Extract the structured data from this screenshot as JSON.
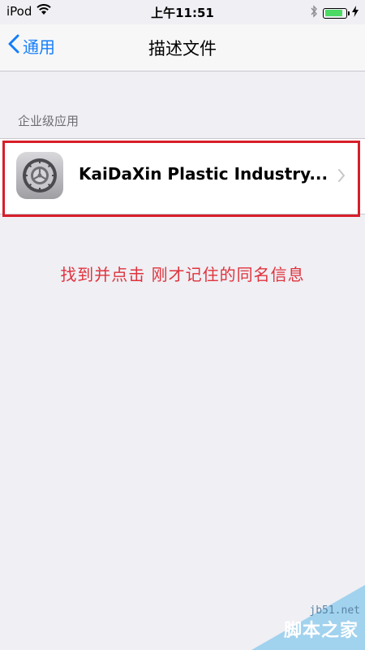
{
  "status_bar": {
    "carrier": "iPod",
    "time": "上午11:51",
    "battery_color": "#4cd964",
    "battery_level": 0.85
  },
  "nav": {
    "back_label": "通用",
    "title": "描述文件",
    "accent_color": "#147efb"
  },
  "section": {
    "header": "企业级应用",
    "items": [
      {
        "label": "KaiDaXin Plastic Industry...",
        "icon": "settings-gear-icon"
      }
    ]
  },
  "annotation": {
    "instruction": "找到并点击 刚才记住的同名信息",
    "color": "#e0333c"
  },
  "watermark": {
    "site": "jb51.net",
    "name": "脚本之家"
  }
}
